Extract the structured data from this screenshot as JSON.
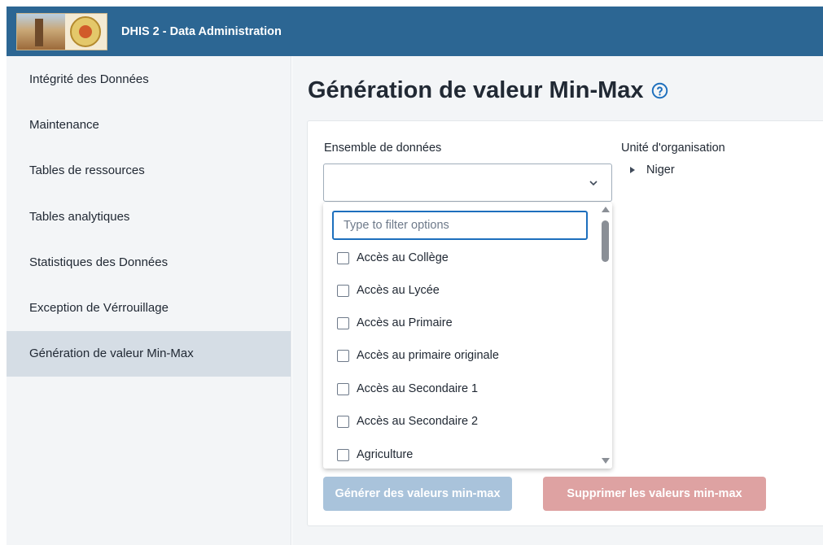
{
  "header": {
    "title": "DHIS 2 - Data Administration",
    "logo_icon": "niger-emblem-logo",
    "background_color": "#2c6693"
  },
  "sidebar": {
    "items": [
      {
        "label": "Intégrité des Données",
        "active": false
      },
      {
        "label": "Maintenance",
        "active": false
      },
      {
        "label": "Tables de ressources",
        "active": false
      },
      {
        "label": "Tables analytiques",
        "active": false
      },
      {
        "label": "Statistiques des Données",
        "active": false
      },
      {
        "label": "Exception de Vérrouillage",
        "active": false
      },
      {
        "label": "Génération de valeur Min-Max",
        "active": true
      }
    ]
  },
  "main": {
    "title": "Génération de valeur Min-Max",
    "help_icon": "help-circle-icon",
    "dataset": {
      "label": "Ensemble de données",
      "value": "",
      "filter_placeholder": "Type to filter options",
      "options": [
        "Accès au Collège",
        "Accès au Lycée",
        "Accès au Primaire",
        "Accès au primaire originale",
        "Accès au Secondaire 1",
        "Accès au Secondaire 2",
        "Agriculture"
      ]
    },
    "org_unit": {
      "label": "Unité d'organisation",
      "root": "Niger"
    },
    "buttons": {
      "generate": "Générer des valeurs min-max",
      "delete": "Supprimer les valeurs min-max"
    }
  }
}
